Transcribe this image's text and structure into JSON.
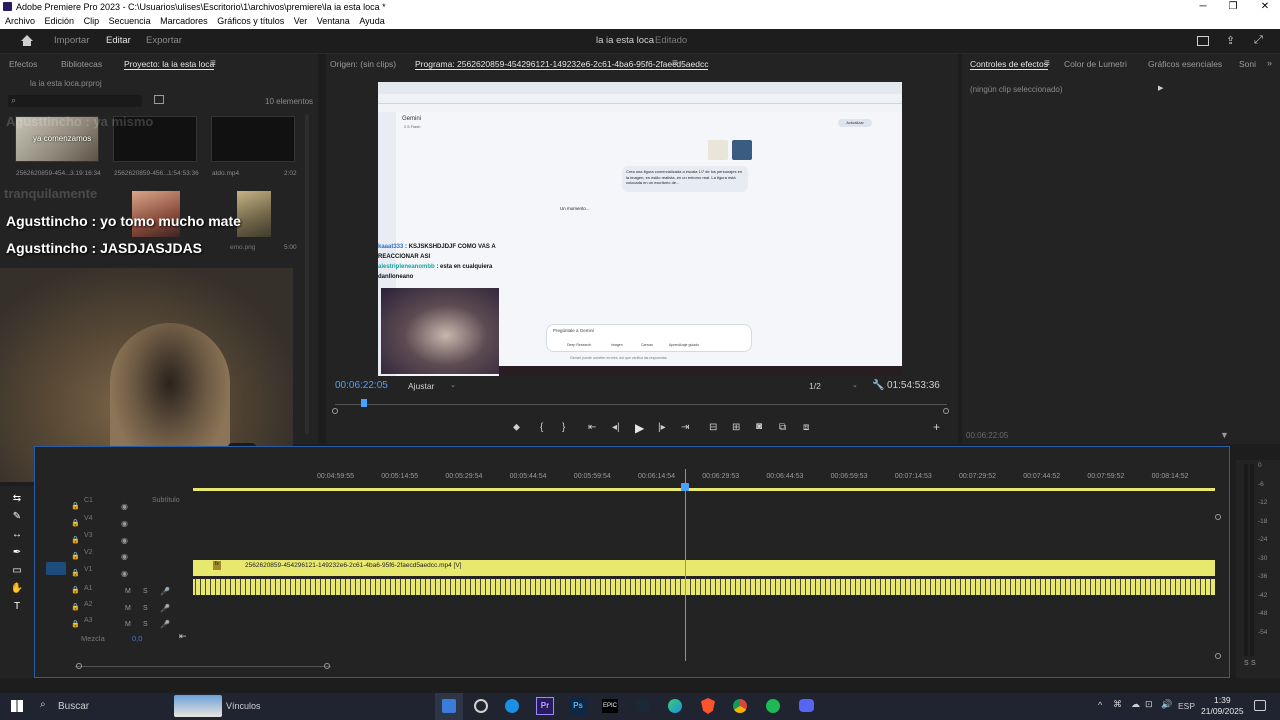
{
  "window": {
    "title": "Adobe Premiere Pro 2023 - C:\\Usuarios\\ulises\\Escritorio\\1\\archivos\\premiere\\la ia esta loca *",
    "minimize": "─",
    "restore": "❐",
    "close": "✕"
  },
  "menu": [
    "Archivo",
    "Edición",
    "Clip",
    "Secuencia",
    "Marcadores",
    "Gráficos y títulos",
    "Ver",
    "Ventana",
    "Ayuda"
  ],
  "workspace": {
    "tabs": [
      "Importar",
      "Editar",
      "Exportar"
    ],
    "active": "Editar",
    "project_title": "la ia esta loca",
    "status": "Editado"
  },
  "left_panel": {
    "tabs": [
      "Efectos",
      "Bibliotecas",
      "Proyecto: la ia esta loca"
    ],
    "project_file": "la ia esta loca.prproj",
    "item_count": "10 elementos",
    "items": [
      {
        "name": "2562620859-454...",
        "duration": "3:19:16:34",
        "overlay": "ya comenzamos"
      },
      {
        "name": "2562620859-456...",
        "duration": "1:54:53:36"
      },
      {
        "name": "atdo.mp4",
        "duration": "2:02"
      },
      {
        "name": "",
        "duration": "5:00"
      }
    ],
    "file_hint": "emo.png"
  },
  "chat_overlay": [
    {
      "user": "Agusttincho",
      "message": ": yo tomo mucho mate"
    },
    {
      "user": "Agusttincho",
      "message": ": JASDJASJDAS"
    }
  ],
  "chat_ghost": [
    "tranquilamente",
    "Agusttincho : ya mismo"
  ],
  "source_monitor": {
    "label": "Origen: (sin clips)"
  },
  "program_monitor": {
    "label": "Programa: 2562620859-454296121-149232e6-2c61-4ba6-95f6-2faecd5aedcc",
    "timecode": "00:06:22:05",
    "fit": "Ajustar",
    "resolution": "1/2",
    "duration": "01:54:53:36"
  },
  "video_content": {
    "gemini_title": "Gemini",
    "gemini_model": "2.5 Flash",
    "update_btn": "Actualizar",
    "prompt_text": "Crea una figura comercializada a escala 1/7 de los personajes en la imagen, en estilo realista, en un entorno real. La figura está colocada en un escritorio de...",
    "loading": "Un momento...",
    "stream_chat": [
      {
        "user": "kaaat333",
        "message": ": KSJSKSHDJDJF COMO VAS A REACCIONAR ASI"
      },
      {
        "user": "alestripleneanombb",
        "message": ": esta en cualquiera danlloneano"
      }
    ],
    "ask_placeholder": "Pregúntale a Gemini",
    "chips": [
      "Deep Research",
      "Imagen",
      "Canvas",
      "Aprendizaje guiado"
    ],
    "disclaimer": "Gemini puede cometer errores, así que verifica las respuestas."
  },
  "right_panel": {
    "tabs": [
      "Controles de efectos",
      "Color de Lumetri",
      "Gráficos esenciales",
      "Soni"
    ],
    "empty": "(ningún clip seleccionado)",
    "footer_tc": "00:06:22:05"
  },
  "timeline": {
    "ruler": [
      "00:04:59:55",
      "00:05:14:55",
      "00:05:29:54",
      "00:05:44:54",
      "00:05:59:54",
      "00:06:14:54",
      "00:06:29:53",
      "00:06:44:53",
      "00:06:59:53",
      "00:07:14:53",
      "00:07:29:52",
      "00:07:44:52",
      "00:07:59:52",
      "00:08:14:52"
    ],
    "tracks": [
      {
        "name": "Subtítulo",
        "id": "C1"
      },
      {
        "name": "",
        "id": "V4"
      },
      {
        "name": "",
        "id": "V3"
      },
      {
        "name": "",
        "id": "V2"
      },
      {
        "name": "",
        "id": "V1"
      },
      {
        "name": "",
        "id": "A1"
      },
      {
        "name": "",
        "id": "A2"
      },
      {
        "name": "",
        "id": "A3"
      }
    ],
    "mix_label": "Mezcla",
    "mix_value": "0,0",
    "clip_label": "2562620859-454296121-149232e6-2c61-4ba6-95f6-2faecd5aedcc.mp4 [V]",
    "clip_fx": "fx"
  },
  "meters": [
    "0",
    "-6",
    "-12",
    "-18",
    "-24",
    "-30",
    "-36",
    "-42",
    "-48",
    "-54"
  ],
  "meters_labels": [
    "S",
    "S"
  ],
  "taskbar": {
    "search": "Buscar",
    "widget": "Vínculos",
    "lang": "ESP",
    "time": "1:39",
    "date": "21/09/2025"
  },
  "colors": {
    "accent": "#2d8ceb",
    "clip": "#e8e86f",
    "playhead": "#4aa0ff"
  }
}
